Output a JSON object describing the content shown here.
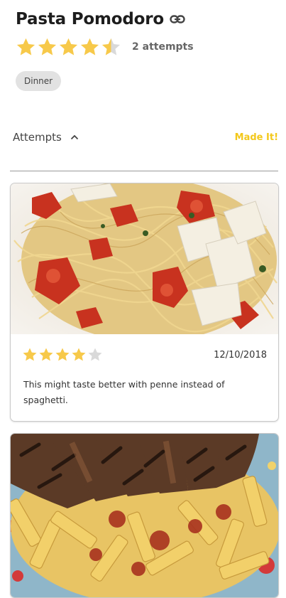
{
  "recipe": {
    "title": "Pasta Pomodoro",
    "rating": 4.5,
    "max_rating": 5,
    "attempts_label": "2 attempts",
    "tag": "Dinner",
    "link_icon": "link-icon"
  },
  "attempts_section": {
    "label": "Attempts",
    "toggle_icon": "chevron-up-icon",
    "made_it_label": "Made It!"
  },
  "attempts": [
    {
      "photo": "spaghetti-with-tomatoes-and-parmesan",
      "rating": 4,
      "max_rating": 5,
      "date": "12/10/2018",
      "note": "This might taste better with penne instead of spaghetti."
    },
    {
      "photo": "penne-with-grilled-chicken"
    }
  ],
  "colors": {
    "star_filled": "#f7c94a",
    "star_empty": "#d9d9d9",
    "accent": "#f3c81b"
  }
}
